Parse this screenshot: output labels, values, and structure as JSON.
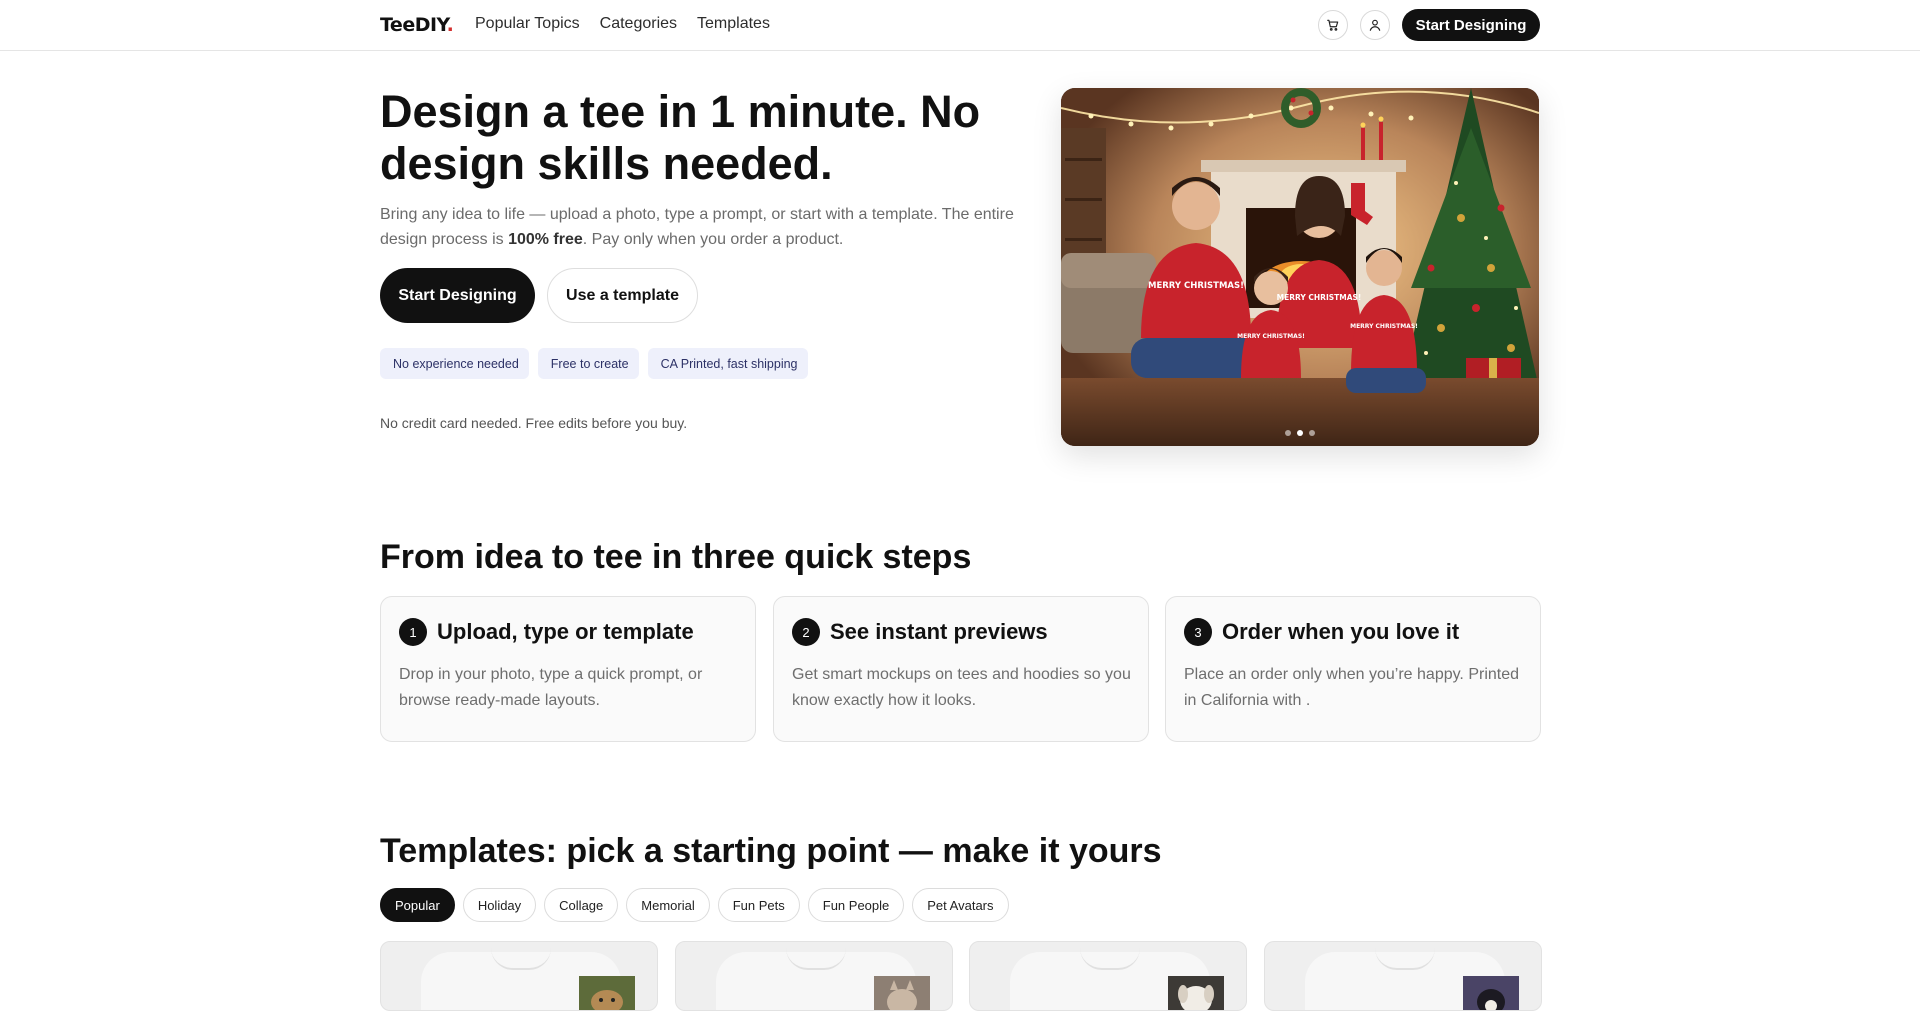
{
  "nav": {
    "logo_main": "TeeDIY",
    "logo_accent": ".",
    "links": [
      "Popular Topics",
      "Categories",
      "Templates"
    ],
    "cart_icon": "cart-icon",
    "user_icon": "user-icon",
    "cta_label": "Start Designing"
  },
  "hero": {
    "title": "Design a tee in 1 minute. No design skills needed.",
    "subtitle_before": "Bring any idea to life — upload a photo, type a prompt, or start with a template. The entire design process is ",
    "subtitle_bold": "100% free",
    "subtitle_after": ". Pay only when you order a product.",
    "primary_button": "Start Designing",
    "secondary_button": "Use a template",
    "badges": [
      {
        "icon": "",
        "label": "No experience needed"
      },
      {
        "icon": "",
        "label": "Free to create"
      },
      {
        "icon": "",
        "label": "CA Printed, fast shipping"
      }
    ],
    "note": "No credit card needed. Free edits before you buy.",
    "carousel": {
      "slides": 3,
      "active_index": 1
    },
    "image_shirt_text": "MERRY CHRISTMAS!"
  },
  "steps": {
    "title": "From idea to tee in three quick steps",
    "items": [
      {
        "number": "1",
        "title": "Upload, type or template",
        "desc": "Drop in your photo, type a quick prompt, or browse ready-made layouts."
      },
      {
        "number": "2",
        "title": "See instant previews",
        "desc": "Get smart mockups on tees and hoodies so you know exactly how it looks."
      },
      {
        "number": "3",
        "title": "Order when you love it",
        "desc": "Place an order only when you’re happy. Printed in California with ."
      }
    ]
  },
  "templates": {
    "title": "Templates: pick a starting point — make it yours",
    "chips": [
      "Popular",
      "Holiday",
      "Collage",
      "Memorial",
      "Fun Pets",
      "Fun People",
      "Pet Avatars"
    ],
    "active_chip": "Popular"
  },
  "colors": {
    "accent": "#d3302f",
    "dark": "#111111",
    "badge_bg": "#eef0fb",
    "badge_text": "#2c3166",
    "sweater_red": "#c8232c"
  }
}
